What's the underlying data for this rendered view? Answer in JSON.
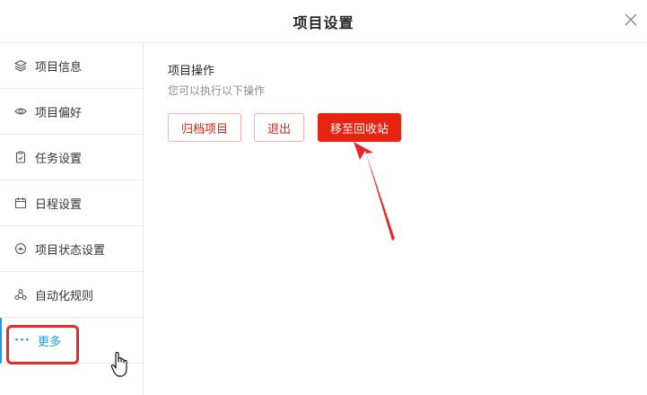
{
  "dialog": {
    "title": "项目设置"
  },
  "sidebar": {
    "items": [
      {
        "label": "项目信息",
        "icon": "layers-icon"
      },
      {
        "label": "项目偏好",
        "icon": "eye-icon"
      },
      {
        "label": "任务设置",
        "icon": "clipboard-icon"
      },
      {
        "label": "日程设置",
        "icon": "calendar-icon"
      },
      {
        "label": "项目状态设置",
        "icon": "status-icon"
      },
      {
        "label": "自动化规则",
        "icon": "automation-icon"
      },
      {
        "label": "更多",
        "icon": "more-dots-icon",
        "active": true
      }
    ]
  },
  "main": {
    "section_title": "项目操作",
    "section_desc": "您可以执行以下操作",
    "buttons": {
      "archive": "归档项目",
      "exit": "退出",
      "trash": "移至回收站"
    }
  },
  "colors": {
    "accent": "#1b9aee",
    "danger": "#e62412",
    "annotation": "#e8272a"
  }
}
